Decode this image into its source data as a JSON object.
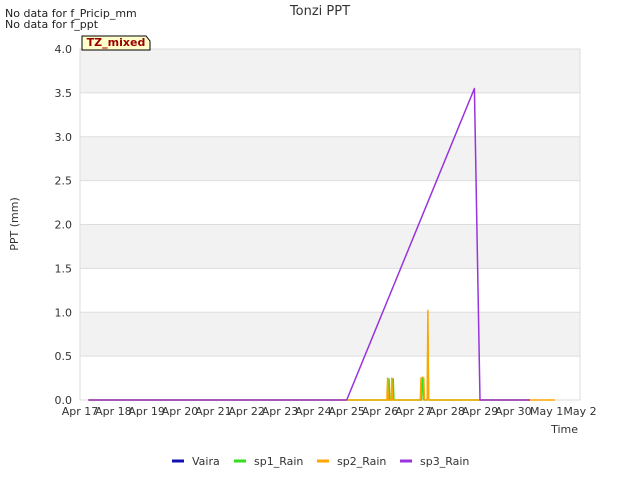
{
  "notes": [
    "No data for f_Pricip_mm",
    "No data for f_ppt"
  ],
  "tz_badge": "TZ_mixed",
  "chart_data": {
    "type": "line",
    "title": "Tonzi PPT",
    "xlabel": "Time",
    "ylabel": "PPT (mm)",
    "ylim": [
      0,
      4
    ],
    "yticks": [
      0,
      0.5,
      1.0,
      1.5,
      2.0,
      2.5,
      3.0,
      3.5,
      4.0
    ],
    "ytick_labels": [
      "0.0",
      "0.5",
      "1.0",
      "1.5",
      "2.0",
      "2.5",
      "3.0",
      "3.5",
      "4.0"
    ],
    "xlim": [
      "Apr 17",
      "May 2"
    ],
    "xtick_labels": [
      "Apr 17",
      "Apr 18",
      "Apr 19",
      "Apr 20",
      "Apr 21",
      "Apr 22",
      "Apr 23",
      "Apr 24",
      "Apr 25",
      "Apr 26",
      "Apr 27",
      "Apr 28",
      "Apr 29",
      "Apr 30",
      "May 1",
      "May 2"
    ],
    "grid": true,
    "legend_position": "bottom",
    "series": [
      {
        "name": "Vaira",
        "color": "#1010b0",
        "points": []
      },
      {
        "name": "sp1_Rain",
        "color": "#33dd22",
        "points": [
          [
            "Apr 17 06:00",
            0
          ],
          [
            "Apr 26 06:00",
            0
          ],
          [
            "Apr 26 06:30",
            0.24
          ],
          [
            "Apr 26 07:00",
            0
          ],
          [
            "Apr 26 09:00",
            0
          ],
          [
            "Apr 26 09:30",
            0.24
          ],
          [
            "Apr 26 10:00",
            0
          ],
          [
            "Apr 27 06:00",
            0
          ],
          [
            "Apr 27 06:30",
            0.24
          ],
          [
            "Apr 27 07:00",
            0.24
          ],
          [
            "Apr 27 07:30",
            0
          ],
          [
            "Apr 27 10:00",
            0
          ],
          [
            "Apr 27 10:30",
            0.75
          ],
          [
            "Apr 27 11:00",
            0
          ],
          [
            "Apr 30 12:00",
            0
          ]
        ]
      },
      {
        "name": "sp2_Rain",
        "color": "#ffa500",
        "points": [
          [
            "Apr 17 06:00",
            0
          ],
          [
            "Apr 26 05:00",
            0
          ],
          [
            "Apr 26 05:30",
            0.25
          ],
          [
            "Apr 26 06:00",
            0
          ],
          [
            "Apr 26 08:00",
            0
          ],
          [
            "Apr 26 08:30",
            0.25
          ],
          [
            "Apr 26 09:00",
            0
          ],
          [
            "Apr 27 05:00",
            0
          ],
          [
            "Apr 27 05:30",
            0.25
          ],
          [
            "Apr 27 06:30",
            0.26
          ],
          [
            "Apr 27 07:30",
            0.25
          ],
          [
            "Apr 27 08:00",
            0
          ],
          [
            "Apr 27 10:00",
            0
          ],
          [
            "Apr 27 10:30",
            1.02
          ],
          [
            "Apr 27 11:00",
            0
          ],
          [
            "May 1 06:00",
            0
          ]
        ]
      },
      {
        "name": "sp3_Rain",
        "color": "#9933dd",
        "points": [
          [
            "Apr 17 06:00",
            0
          ],
          [
            "Apr 25 00:00",
            0
          ],
          [
            "Apr 28 20:00",
            3.55
          ],
          [
            "Apr 29 00:00",
            0
          ],
          [
            "Apr 30 12:00",
            0
          ]
        ]
      }
    ]
  }
}
